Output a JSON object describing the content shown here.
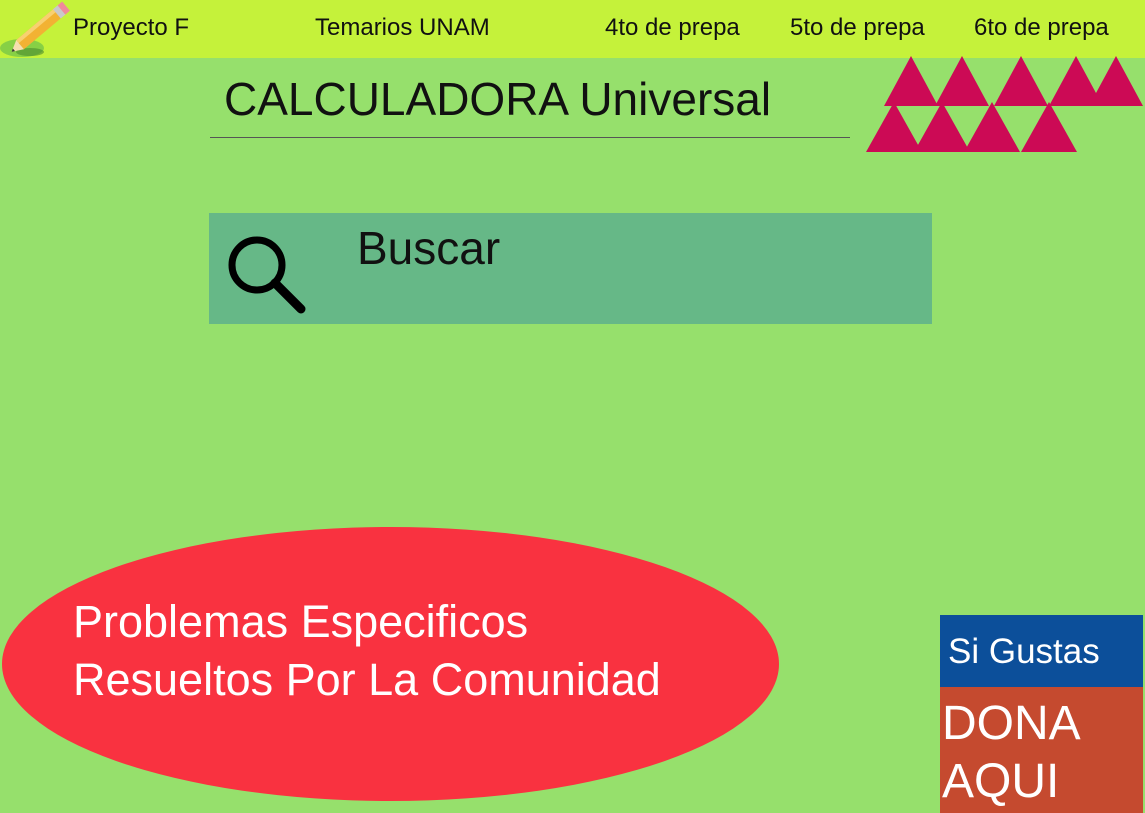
{
  "nav": {
    "items": [
      {
        "label": "Proyecto F"
      },
      {
        "label": "Temarios UNAM"
      },
      {
        "label": "4to de prepa"
      },
      {
        "label": "5to de prepa"
      },
      {
        "label": "6to de prepa"
      }
    ]
  },
  "header": {
    "title": "CALCULADORA Universal"
  },
  "search": {
    "label": "Buscar",
    "icon": "search-icon"
  },
  "community": {
    "line1": "Problemas Especificos",
    "line2": "Resueltos Por La Comunidad"
  },
  "donate": {
    "top_label": "Si Gustas",
    "cta_label": "DONA\nAQUI"
  },
  "colors": {
    "background": "#96e06c",
    "topbar": "#c5f23a",
    "search": "#66b887",
    "ellipse": "#f93240",
    "triangles": "#cc0a55",
    "donate_top": "#0c4f9a",
    "donate_bottom": "#c54a2f"
  },
  "icons": {
    "logo": "pencil-icon",
    "decoration": "triangles-icon"
  }
}
